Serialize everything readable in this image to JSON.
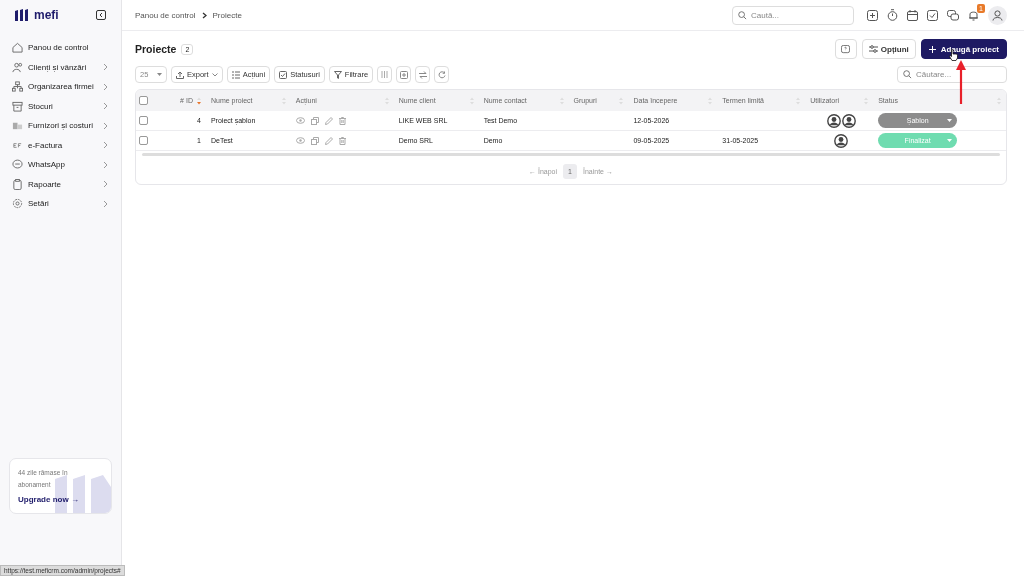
{
  "sidebar": {
    "logo": "mefi",
    "items": [
      {
        "label": "Panou de control",
        "expandable": false
      },
      {
        "label": "Clienți și vânzări",
        "expandable": true
      },
      {
        "label": "Organizarea firmei",
        "expandable": true
      },
      {
        "label": "Stocuri",
        "expandable": true
      },
      {
        "label": "Furnizori și costuri",
        "expandable": true
      },
      {
        "label": "e-Factura",
        "expandable": true
      },
      {
        "label": "WhatsApp",
        "expandable": true
      },
      {
        "label": "Rapoarte",
        "expandable": true
      },
      {
        "label": "Setări",
        "expandable": true
      }
    ],
    "upgrade": {
      "text": "44 zile rămase în abonament",
      "link": "Upgrade now →"
    }
  },
  "topbar": {
    "breadcrumb": [
      "Panou de control",
      "Proiecte"
    ],
    "search": {
      "placeholder": "Caută..."
    },
    "notification_count": "1"
  },
  "header": {
    "title": "Proiecte",
    "count": "2",
    "options": "Opțiuni",
    "add": "Adaugă proiect"
  },
  "toolbar": {
    "page_size": "25",
    "buttons": [
      {
        "label": "Export",
        "caret": true
      },
      {
        "label": "Acțiuni",
        "caret": false
      },
      {
        "label": "Statusuri",
        "caret": false
      },
      {
        "label": "Filtrare",
        "caret": false
      }
    ],
    "search": {
      "placeholder": "Căutare..."
    }
  },
  "table": {
    "all_selected": false,
    "columns": [
      {
        "label": "# ID",
        "sorted": true
      },
      {
        "label": "Nume proiect",
        "sorted": false
      },
      {
        "label": "Acțiuni",
        "sorted": false
      },
      {
        "label": "Nume client",
        "sorted": false
      },
      {
        "label": "Nume contact",
        "sorted": false
      },
      {
        "label": "Grupuri",
        "sorted": false
      },
      {
        "label": "Data începere",
        "sorted": false
      },
      {
        "label": "Termen limită",
        "sorted": false
      },
      {
        "label": "Utilizatori",
        "sorted": false
      },
      {
        "label": "Status",
        "sorted": false
      }
    ],
    "rows": [
      {
        "checked": false,
        "id": "4",
        "name": "Proiect șablon",
        "client": "LIKE WEB SRL",
        "contact": "Test Demo",
        "start": "12-05-2026",
        "users": [
          {
            "kind": "avatar"
          },
          {
            "kind": "avatar"
          }
        ],
        "status": {
          "label": "Șablon",
          "color": "#8c8c8c"
        }
      },
      {
        "checked": false,
        "id": "1",
        "name": "DeTest",
        "client": "Demo SRL",
        "contact": "Demo",
        "start": "09-05-2025",
        "deadline": "31-05-2025",
        "users": [
          {
            "kind": "avatar"
          }
        ],
        "status": {
          "label": "Finalizat",
          "color": "#6fdcb0"
        }
      }
    ]
  },
  "pagination": {
    "prev": {
      "label": "← Înapoi",
      "disabled": true
    },
    "pages": [
      {
        "label": "1",
        "selected": true
      }
    ],
    "next": {
      "label": "Înainte →",
      "disabled": true
    }
  },
  "status_bar": "https://test.meficrm.com/admin/projects#"
}
